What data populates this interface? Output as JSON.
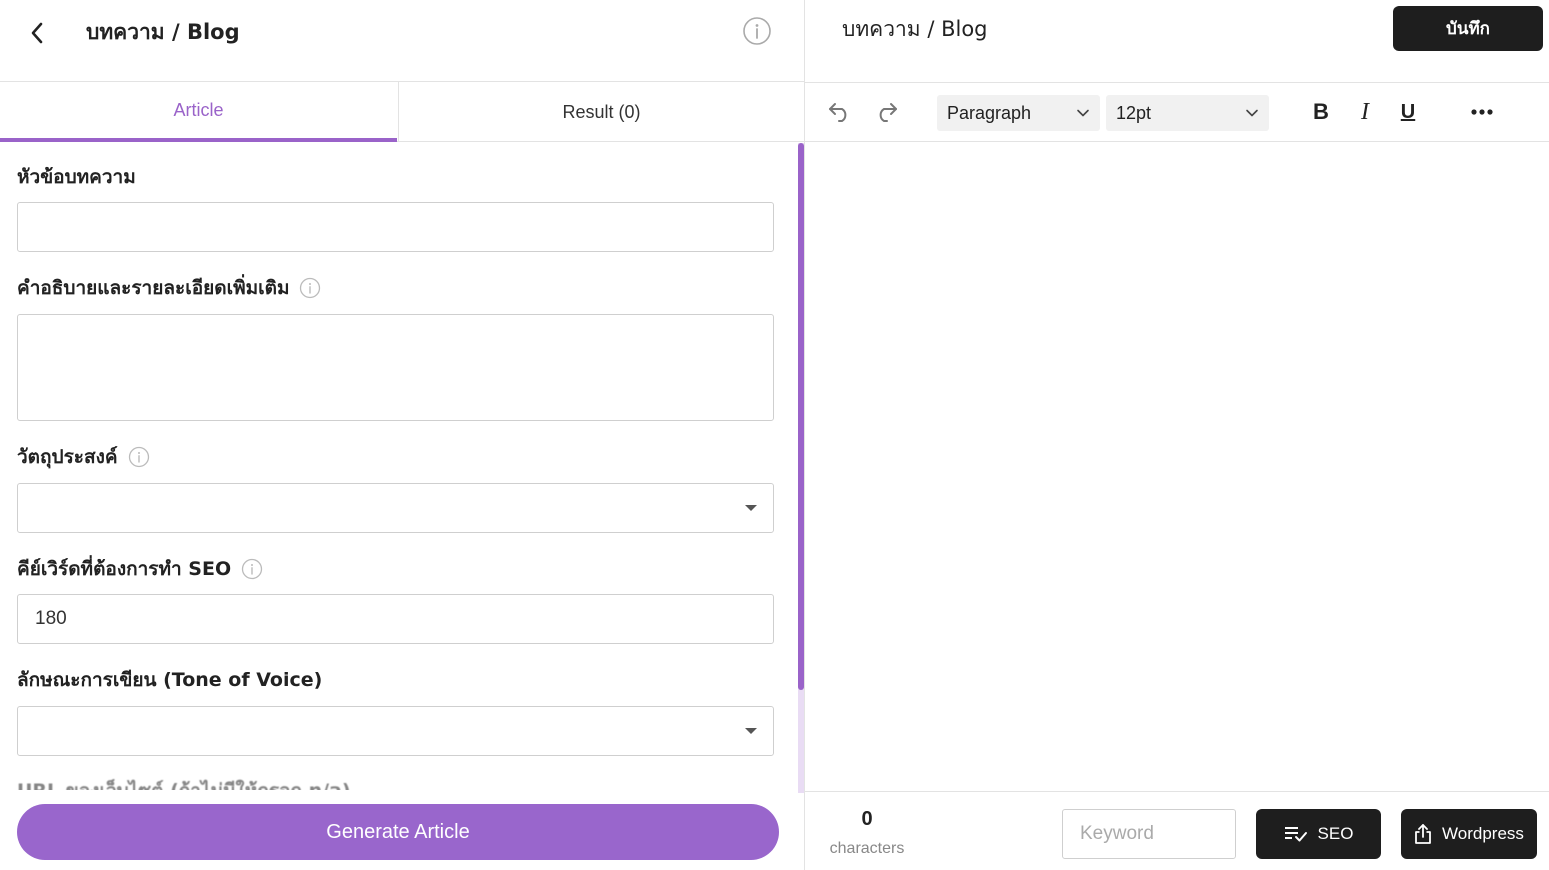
{
  "header": {
    "back_icon": "chevron-left-icon",
    "title": "บทความ / Blog",
    "info_icon": "info-circle-icon"
  },
  "tabs": [
    {
      "label": "Article",
      "active": true
    },
    {
      "label": "Result (0)",
      "active": false
    }
  ],
  "form": {
    "topic": {
      "label": "หัวข้อบทความ",
      "value": ""
    },
    "description": {
      "label": "คำอธิบายและรายละเอียดเพิ่มเติม",
      "value": ""
    },
    "objective": {
      "label": "วัตถุประสงค์",
      "value": ""
    },
    "keywords": {
      "label": "คีย์เวิร์ดที่ต้องการทำ SEO",
      "value": "180"
    },
    "tone": {
      "label": "ลักษณะการเขียน (Tone of Voice)",
      "value": ""
    },
    "url_partial_label": "URL ของเว็บไซต์ (ถ้าไม่มีให้กรอก n/a)"
  },
  "generate_button": "Generate Article",
  "editor": {
    "title": "บทความ / Blog",
    "save_label": "บันทึก",
    "toolbar": {
      "block_format": "Paragraph",
      "font_size": "12pt",
      "bold": "B",
      "italic": "I",
      "underline": "U"
    },
    "footer": {
      "char_count": "0",
      "char_label": "characters",
      "keyword_placeholder": "Keyword",
      "seo_label": "SEO",
      "wordpress_label": "Wordpress"
    }
  },
  "colors": {
    "accent": "#9966cc",
    "dark_button": "#1e1e1e"
  }
}
